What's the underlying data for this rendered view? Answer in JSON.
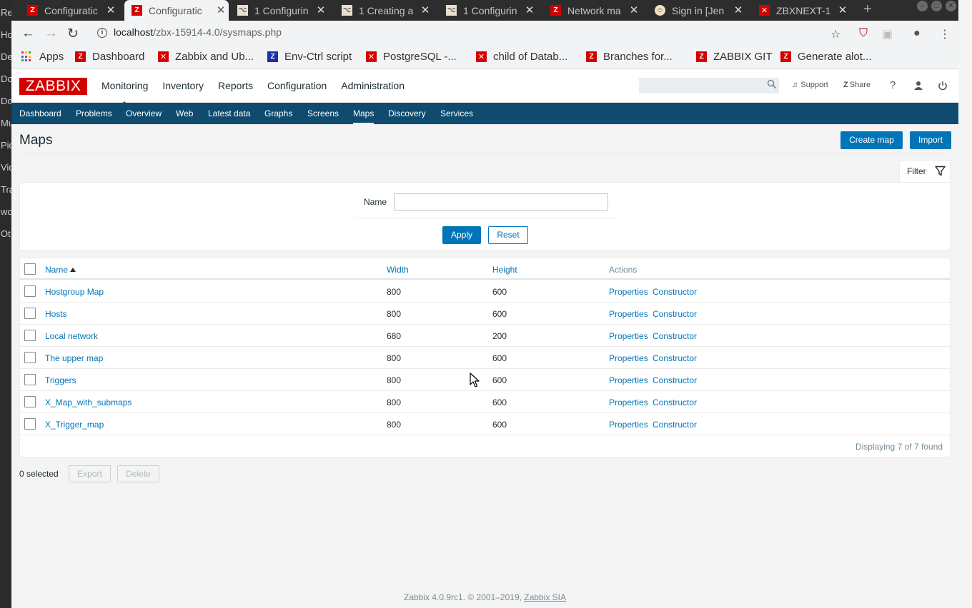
{
  "desktop": {
    "left_labels": [
      "Re",
      "Ho",
      "De",
      "Do",
      "Do",
      "Mu",
      "Pic",
      "Vid",
      "Tra",
      "wo",
      "Ot"
    ]
  },
  "browser": {
    "tabs": [
      {
        "title": "Configuratic",
        "icon": "zabbix-icon",
        "active": false
      },
      {
        "title": "Configuratic",
        "icon": "zabbix-icon",
        "active": true
      },
      {
        "title": "1 Configurin",
        "icon": "git-icon",
        "active": false
      },
      {
        "title": "1 Creating a",
        "icon": "git-icon",
        "active": false
      },
      {
        "title": "1 Configurin",
        "icon": "git-icon",
        "active": false
      },
      {
        "title": "Network ma",
        "icon": "zabbix-icon",
        "active": false
      },
      {
        "title": "Sign in [Jen",
        "icon": "jenkins-icon",
        "active": false
      },
      {
        "title": "ZBXNEXT-1",
        "icon": "jira-icon",
        "active": false
      }
    ],
    "url_host": "localhost",
    "url_path": "/zbx-15914-4.0/sysmaps.php",
    "bookmarks": [
      {
        "label": "Apps",
        "icon": "apps-icon"
      },
      {
        "label": "Dashboard",
        "icon": "zabbix-icon"
      },
      {
        "label": "Zabbix and Ub...",
        "icon": "jira-icon"
      },
      {
        "label": "Env-Ctrl script",
        "icon": "zabbix-blue-icon"
      },
      {
        "label": "PostgreSQL -...",
        "icon": "jira-icon"
      },
      {
        "label": "child of Datab...",
        "icon": "jira-icon"
      },
      {
        "label": "Branches for...",
        "icon": "zabbix-icon"
      },
      {
        "label": "ZABBIX GIT",
        "icon": "zabbix-icon"
      },
      {
        "label": "Generate alot...",
        "icon": "zabbix-icon"
      }
    ]
  },
  "zabbix": {
    "logo": "ZABBIX",
    "top_menu": [
      "Monitoring",
      "Inventory",
      "Reports",
      "Configuration",
      "Administration"
    ],
    "header_links": {
      "support": "Support",
      "share": "Share",
      "help": "?"
    },
    "sub_menu": [
      "Dashboard",
      "Problems",
      "Overview",
      "Web",
      "Latest data",
      "Graphs",
      "Screens",
      "Maps",
      "Discovery",
      "Services"
    ],
    "page_title": "Maps",
    "buttons": {
      "create_map": "Create map",
      "import": "Import"
    },
    "filter": {
      "tab_label": "Filter",
      "name_label": "Name",
      "name_value": "",
      "apply": "Apply",
      "reset": "Reset"
    },
    "table": {
      "columns": {
        "name": "Name",
        "width": "Width",
        "height": "Height",
        "actions": "Actions"
      },
      "rows": [
        {
          "name": "Hostgroup Map",
          "width": "800",
          "height": "600"
        },
        {
          "name": "Hosts",
          "width": "800",
          "height": "600"
        },
        {
          "name": "Local network",
          "width": "680",
          "height": "200"
        },
        {
          "name": "The upper map",
          "width": "800",
          "height": "600"
        },
        {
          "name": "Triggers",
          "width": "800",
          "height": "600"
        },
        {
          "name": "X_Map_with_submaps",
          "width": "800",
          "height": "600"
        },
        {
          "name": "X_Trigger_map",
          "width": "800",
          "height": "600"
        }
      ],
      "action_properties": "Properties",
      "action_constructor": "Constructor",
      "footer": "Displaying 7 of 7 found"
    },
    "selection": {
      "count": "0 selected",
      "export": "Export",
      "delete": "Delete"
    },
    "copyright": "Zabbix 4.0.9rc1. © 2001–2019,",
    "copyright_link": "Zabbix SIA"
  }
}
